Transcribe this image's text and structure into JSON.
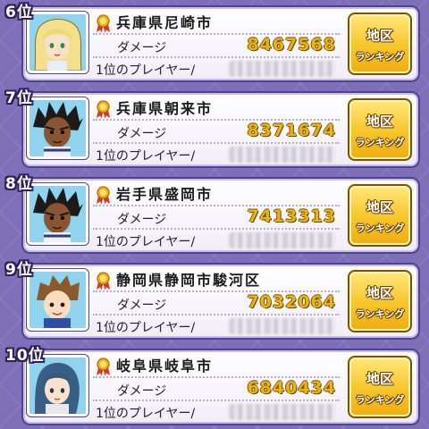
{
  "labels": {
    "damage": "ダメージ",
    "first_player": "1位のプレイヤー/",
    "button_line1": "地区",
    "button_line2": "ランキング"
  },
  "rows": [
    {
      "rank": "6位",
      "city": "兵庫県尼崎市",
      "score": "8467568",
      "avatar": "blonde-hair-character"
    },
    {
      "rank": "7位",
      "city": "兵庫県朝来市",
      "score": "8371674",
      "avatar": "dark-skin-spiky-hair-character"
    },
    {
      "rank": "8位",
      "city": "岩手県盛岡市",
      "score": "7413313",
      "avatar": "dark-skin-spiky-hair-character"
    },
    {
      "rank": "9位",
      "city": "静岡県静岡市駿河区",
      "score": "7032064",
      "avatar": "brown-spiky-hair-character"
    },
    {
      "rank": "10位",
      "city": "岐阜県岐阜市",
      "score": "6840434",
      "avatar": "blue-hair-character"
    }
  ],
  "colors": {
    "background": "#7d6fb8",
    "card": "#ffffff",
    "score_gold": "#e9b314",
    "button_gold": "#f8c52a",
    "border": "#4f4390"
  }
}
